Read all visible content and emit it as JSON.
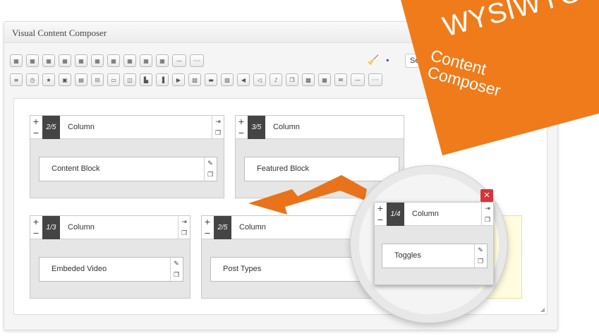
{
  "panel": {
    "title": "Visual Content Composer"
  },
  "toolbar": {
    "row1_count": 10,
    "select_label": "Se",
    "icons_row1": [
      "layout-1-icon",
      "layout-2-icon",
      "layout-3-icon",
      "layout-4-icon",
      "layout-5-icon",
      "layout-6-icon",
      "layout-7-icon",
      "layout-8-icon",
      "layout-9-icon",
      "layout-10-icon",
      "divider-line-icon",
      "dotted-divider-icon"
    ],
    "icons_row2": [
      "list-icon",
      "clock-icon",
      "star-icon",
      "gallery-icon",
      "text-block-icon",
      "settings-block-icon",
      "window-icon",
      "columns-icon",
      "blocks-icon",
      "sidebar-icon",
      "video-icon",
      "document-icon",
      "slider-icon",
      "image-icon",
      "audio-icon",
      "volume-icon",
      "music-icon",
      "copy-icon",
      "picture-icon",
      "post-icon",
      "email-icon",
      "line-icon",
      "dots-icon"
    ]
  },
  "columns": [
    {
      "fraction": "2/5",
      "title": "Column",
      "block": "Content Block"
    },
    {
      "fraction": "3/5",
      "title": "Column",
      "block": "Featured Block"
    },
    {
      "fraction": "1/3",
      "title": "Column",
      "block": "Embeded Video"
    },
    {
      "fraction": "2/5",
      "title": "Column",
      "block": "Post Types"
    }
  ],
  "zoom": {
    "fraction": "1/4",
    "title": "Column",
    "block": "Toggles"
  },
  "banner": {
    "title": "WYSIWYG",
    "subtitle_line1": "Content",
    "subtitle_line2": "Composer"
  },
  "colors": {
    "accent": "#f07b1b",
    "dark": "#444444",
    "close": "#d9333a"
  }
}
